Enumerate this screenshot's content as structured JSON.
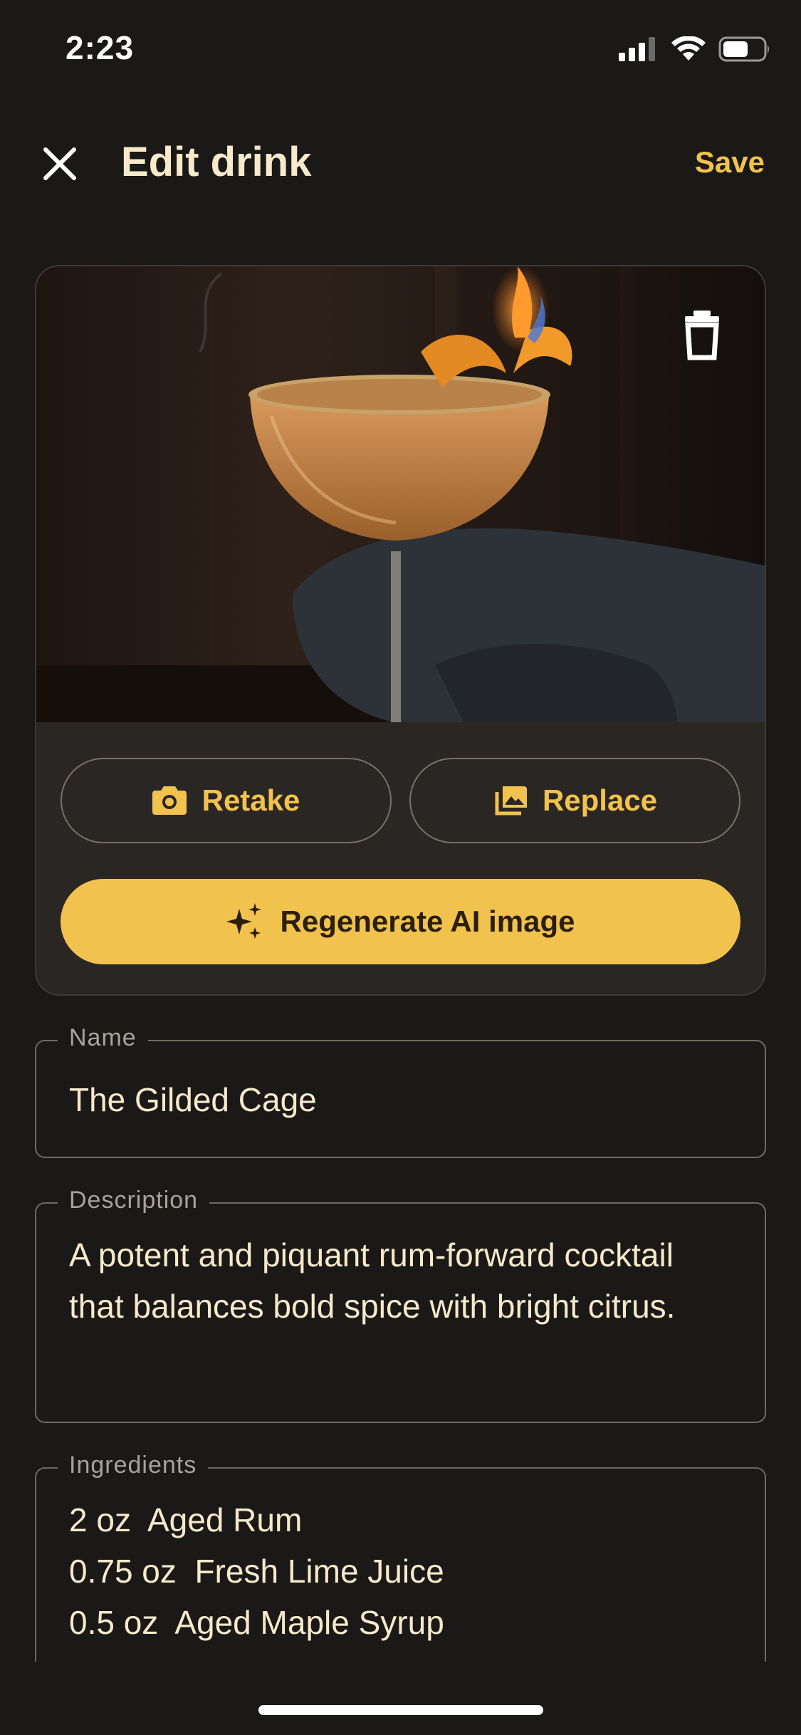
{
  "status_bar": {
    "time": "2:23"
  },
  "header": {
    "title": "Edit drink",
    "save_label": "Save"
  },
  "image_card": {
    "retake_label": "Retake",
    "replace_label": "Replace",
    "regenerate_label": "Regenerate AI image"
  },
  "fields": {
    "name": {
      "label": "Name",
      "value": "The Gilded Cage"
    },
    "description": {
      "label": "Description",
      "value": "A potent and piquant rum-forward cocktail that balances bold spice with bright citrus."
    },
    "ingredients": {
      "label": "Ingredients",
      "lines": [
        "2 oz  Aged Rum",
        "0.75 oz  Fresh Lime Juice",
        "0.5 oz  Aged Maple Syrup"
      ]
    }
  },
  "colors": {
    "background": "#1b1918",
    "accent": "#f2c24f",
    "text": "#f6eacb",
    "card": "#2a2624"
  },
  "icons": [
    "close-icon",
    "trash-icon",
    "camera-icon",
    "image-icon",
    "sparkle-icon",
    "signal-icon",
    "wifi-icon",
    "battery-icon"
  ]
}
